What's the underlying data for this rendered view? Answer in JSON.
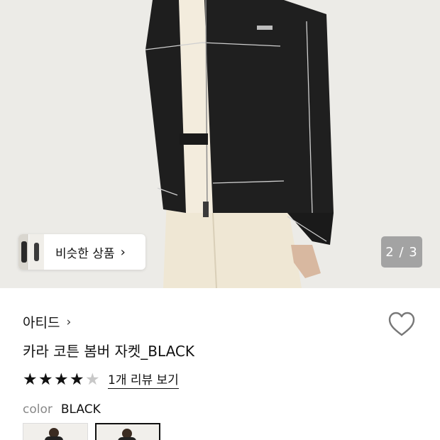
{
  "hero": {
    "image_icon": "product-photo-model-black-bomber-jacket",
    "similar": {
      "label": "비슷한 상품",
      "chevron": "›"
    },
    "pager": {
      "current": "2",
      "separator": "/",
      "total": "3",
      "text": "2 / 3"
    }
  },
  "product": {
    "brand": "아티드",
    "brand_chevron": "›",
    "title": "카라 코튼 봄버 자켓_BLACK",
    "rating": {
      "filled": 4,
      "max": 5,
      "review_text": "1개 리뷰 보기"
    },
    "color": {
      "label": "color",
      "value": "BLACK"
    },
    "swatches": [
      {
        "selected": false
      },
      {
        "selected": true
      }
    ]
  },
  "colors": {
    "background": "#ffffff",
    "hero_bg": "#ecebe7",
    "jacket": "#1e1e1e",
    "pants": "#efe7d4",
    "pager_bg": "#969696",
    "star_filled": "#111111",
    "star_empty": "#c8c8c8"
  }
}
